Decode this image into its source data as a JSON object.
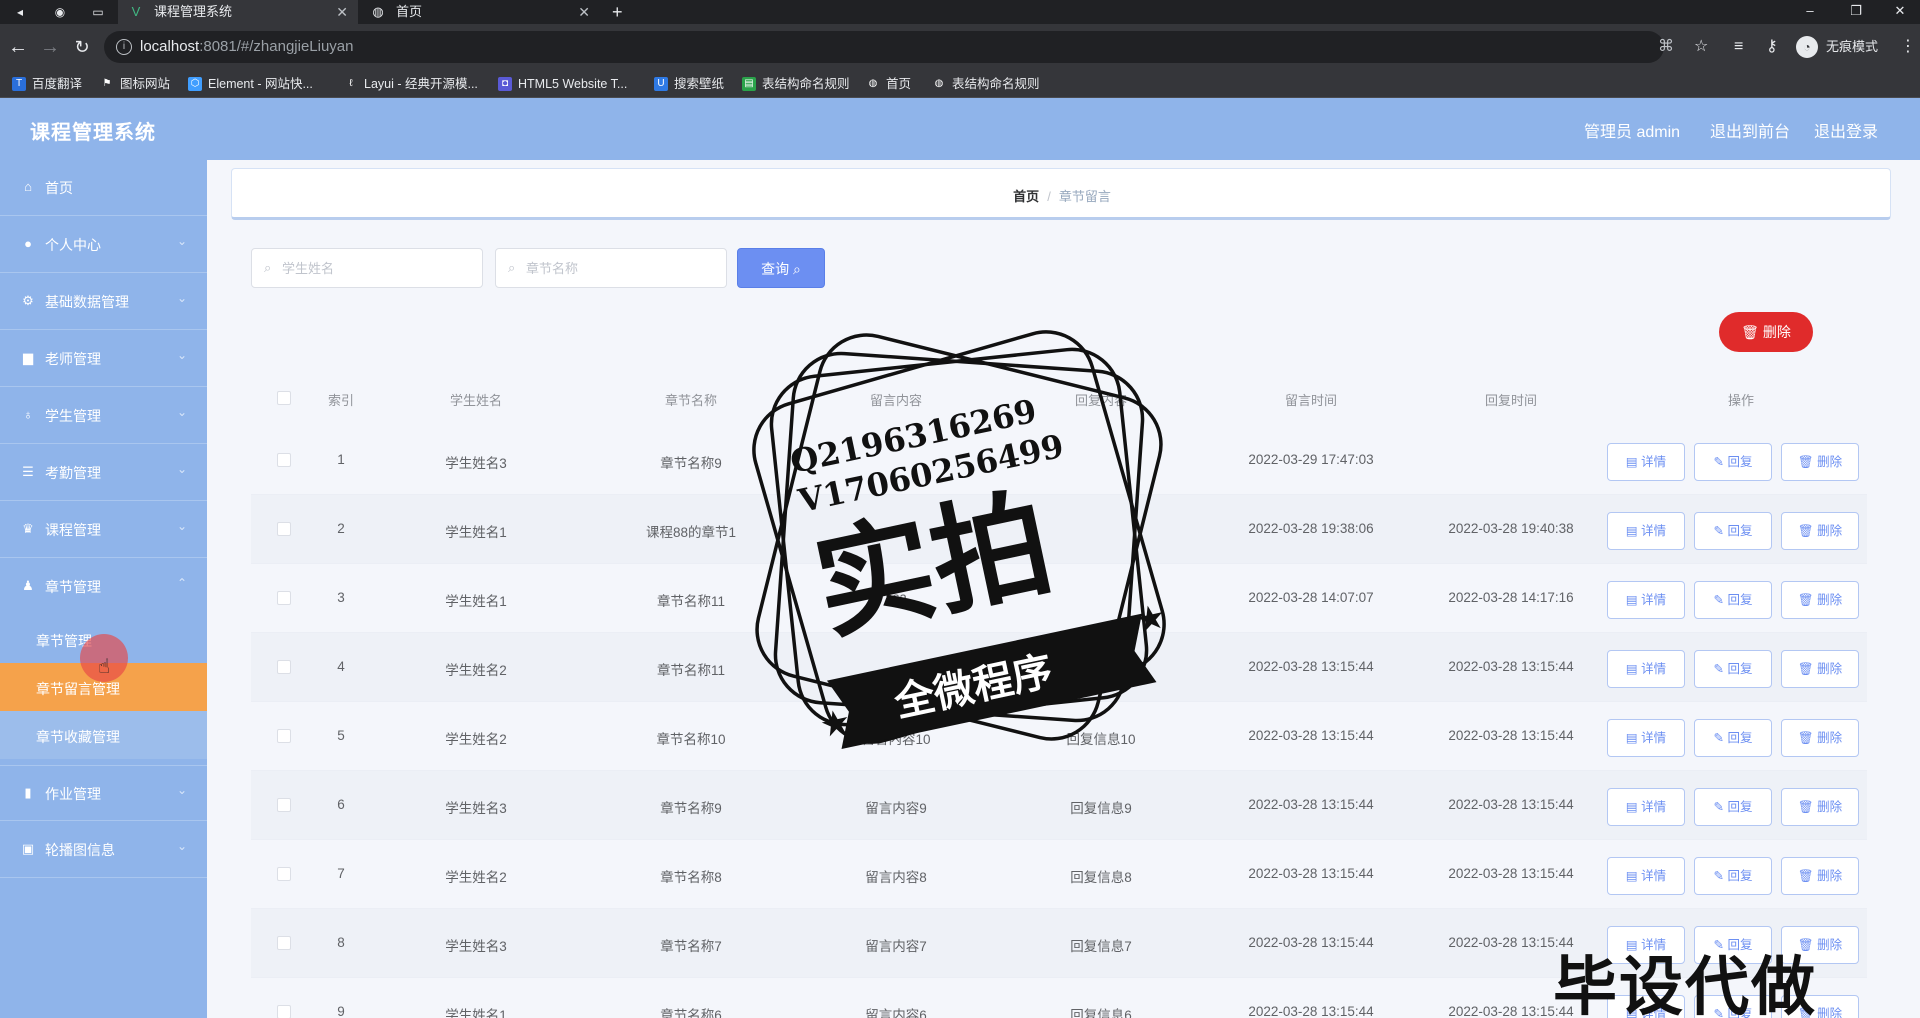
{
  "browser": {
    "tabs": [
      {
        "title": "课程管理系统",
        "active": true
      },
      {
        "title": "首页",
        "active": false
      }
    ],
    "url_host": "localhost",
    "url_rest": ":8081/#/zhangjieLiuyan",
    "incognito_label": "无痕模式",
    "bookmarks": [
      "百度翻译",
      "图标网站",
      "Element - 网站快...",
      "Layui - 经典开源模...",
      "HTML5 Website T...",
      "搜索壁纸",
      "表结构命名规则",
      "首页",
      "表结构命名规则"
    ]
  },
  "header": {
    "title": "课程管理系统",
    "admin": "管理员 admin",
    "back_front": "退出到前台",
    "logout": "退出登录"
  },
  "sidebar": {
    "items": [
      {
        "label": "首页",
        "icon": "home-icon"
      },
      {
        "label": "个人中心",
        "icon": "user-icon"
      },
      {
        "label": "基础数据管理",
        "icon": "settings-icon"
      },
      {
        "label": "老师管理",
        "icon": "folder-icon"
      },
      {
        "label": "学生管理",
        "icon": "bulb-icon"
      },
      {
        "label": "考勤管理",
        "icon": "list-icon"
      },
      {
        "label": "课程管理",
        "icon": "cup-icon"
      },
      {
        "label": "章节管理",
        "icon": "user-icon"
      }
    ],
    "sub_items": [
      "章节管理",
      "章节留言管理",
      "章节收藏管理"
    ],
    "bottom_items": [
      {
        "label": "作业管理",
        "icon": "chart-icon"
      },
      {
        "label": "轮播图信息",
        "icon": "image-icon"
      }
    ]
  },
  "breadcrumb": {
    "home": "首页",
    "current": "章节留言"
  },
  "search": {
    "student_placeholder": "学生姓名",
    "chapter_placeholder": "章节名称",
    "query_label": "查询"
  },
  "delete_label": "删除",
  "table": {
    "headers": [
      "索引",
      "学生姓名",
      "章节名称",
      "留言内容",
      "回复内容",
      "留言时间",
      "回复时间",
      "操作"
    ],
    "rows": [
      {
        "idx": "1",
        "student": "学生姓名3",
        "chapter": "章节名称9",
        "message": "",
        "reply": "",
        "msg_time": "2022-03-29 17:47:03",
        "reply_time": ""
      },
      {
        "idx": "2",
        "student": "学生姓名1",
        "chapter": "课程88的章节1",
        "message": "",
        "reply": "",
        "msg_time": "2022-03-28 19:38:06",
        "reply_time": "2022-03-28 19:40:38"
      },
      {
        "idx": "3",
        "student": "学生姓名1",
        "chapter": "章节名称11",
        "message": "asa",
        "reply": "",
        "msg_time": "2022-03-28 14:07:07",
        "reply_time": "2022-03-28 14:17:16"
      },
      {
        "idx": "4",
        "student": "学生姓名2",
        "chapter": "章节名称11",
        "message": "",
        "reply": "",
        "msg_time": "2022-03-28 13:15:44",
        "reply_time": "2022-03-28 13:15:44"
      },
      {
        "idx": "5",
        "student": "学生姓名2",
        "chapter": "章节名称10",
        "message": "留言内容10",
        "reply": "回复信息10",
        "msg_time": "2022-03-28 13:15:44",
        "reply_time": "2022-03-28 13:15:44"
      },
      {
        "idx": "6",
        "student": "学生姓名3",
        "chapter": "章节名称9",
        "message": "留言内容9",
        "reply": "回复信息9",
        "msg_time": "2022-03-28 13:15:44",
        "reply_time": "2022-03-28 13:15:44"
      },
      {
        "idx": "7",
        "student": "学生姓名2",
        "chapter": "章节名称8",
        "message": "留言内容8",
        "reply": "回复信息8",
        "msg_time": "2022-03-28 13:15:44",
        "reply_time": "2022-03-28 13:15:44"
      },
      {
        "idx": "8",
        "student": "学生姓名3",
        "chapter": "章节名称7",
        "message": "留言内容7",
        "reply": "回复信息7",
        "msg_time": "2022-03-28 13:15:44",
        "reply_time": "2022-03-28 13:15:44"
      },
      {
        "idx": "9",
        "student": "学生姓名1",
        "chapter": "章节名称6",
        "message": "留言内容6",
        "reply": "回复信息6",
        "msg_time": "2022-03-28 13:15:44",
        "reply_time": "2022-03-28 13:15:44"
      }
    ],
    "actions": {
      "detail": "详情",
      "reply": "回复",
      "delete": "删除"
    }
  },
  "watermark": {
    "qq": "Q2196316269",
    "wechat": "V17060256499",
    "big": "实拍",
    "banner": "全微程序",
    "bottom": "毕设代做"
  },
  "colors": {
    "header_bg": "#8fb4ea",
    "active_menu": "#f5a24b",
    "primary": "#6c8ff2",
    "danger": "#e02b2b"
  }
}
